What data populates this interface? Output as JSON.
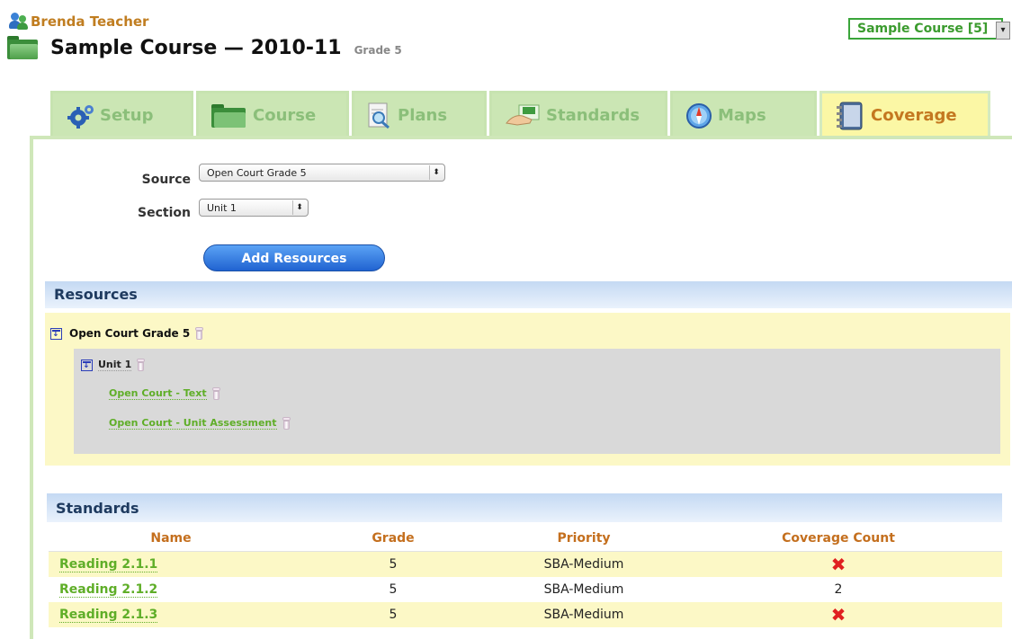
{
  "user": {
    "name": "Brenda Teacher"
  },
  "course": {
    "title": "Sample Course — 2010-11",
    "grade": "Grade 5",
    "selector": "Sample Course [5]"
  },
  "tabs": [
    {
      "label": "Setup",
      "icon": "gear-icon"
    },
    {
      "label": "Course",
      "icon": "folder-icon"
    },
    {
      "label": "Plans",
      "icon": "magnifier-doc-icon"
    },
    {
      "label": "Standards",
      "icon": "hand-card-icon"
    },
    {
      "label": "Maps",
      "icon": "compass-icon"
    },
    {
      "label": "Coverage",
      "icon": "binder-icon",
      "active": true
    }
  ],
  "form": {
    "source_label": "Source",
    "source_value": "Open Court Grade 5",
    "section_label": "Section",
    "section_value": "Unit 1",
    "add_button": "Add Resources"
  },
  "resources": {
    "heading": "Resources",
    "root": "Open Court Grade 5",
    "unit": "Unit 1",
    "items": [
      "Open Court - Text",
      "Open Court - Unit Assessment"
    ]
  },
  "standards": {
    "heading": "Standards",
    "columns": [
      "Name",
      "Grade",
      "Priority",
      "Coverage Count"
    ],
    "rows": [
      {
        "name": "Reading 2.1.1",
        "grade": "5",
        "priority": "SBA-Medium",
        "coverage": "✖"
      },
      {
        "name": "Reading 2.1.2",
        "grade": "5",
        "priority": "SBA-Medium",
        "coverage": "2"
      },
      {
        "name": "Reading 2.1.3",
        "grade": "5",
        "priority": "SBA-Medium",
        "coverage": "✖"
      }
    ]
  },
  "colors": {
    "brand_green": "#5fae28",
    "accent_orange": "#c47820",
    "tab_green": "#cbe6b4",
    "tab_active": "#fbf7a5"
  }
}
